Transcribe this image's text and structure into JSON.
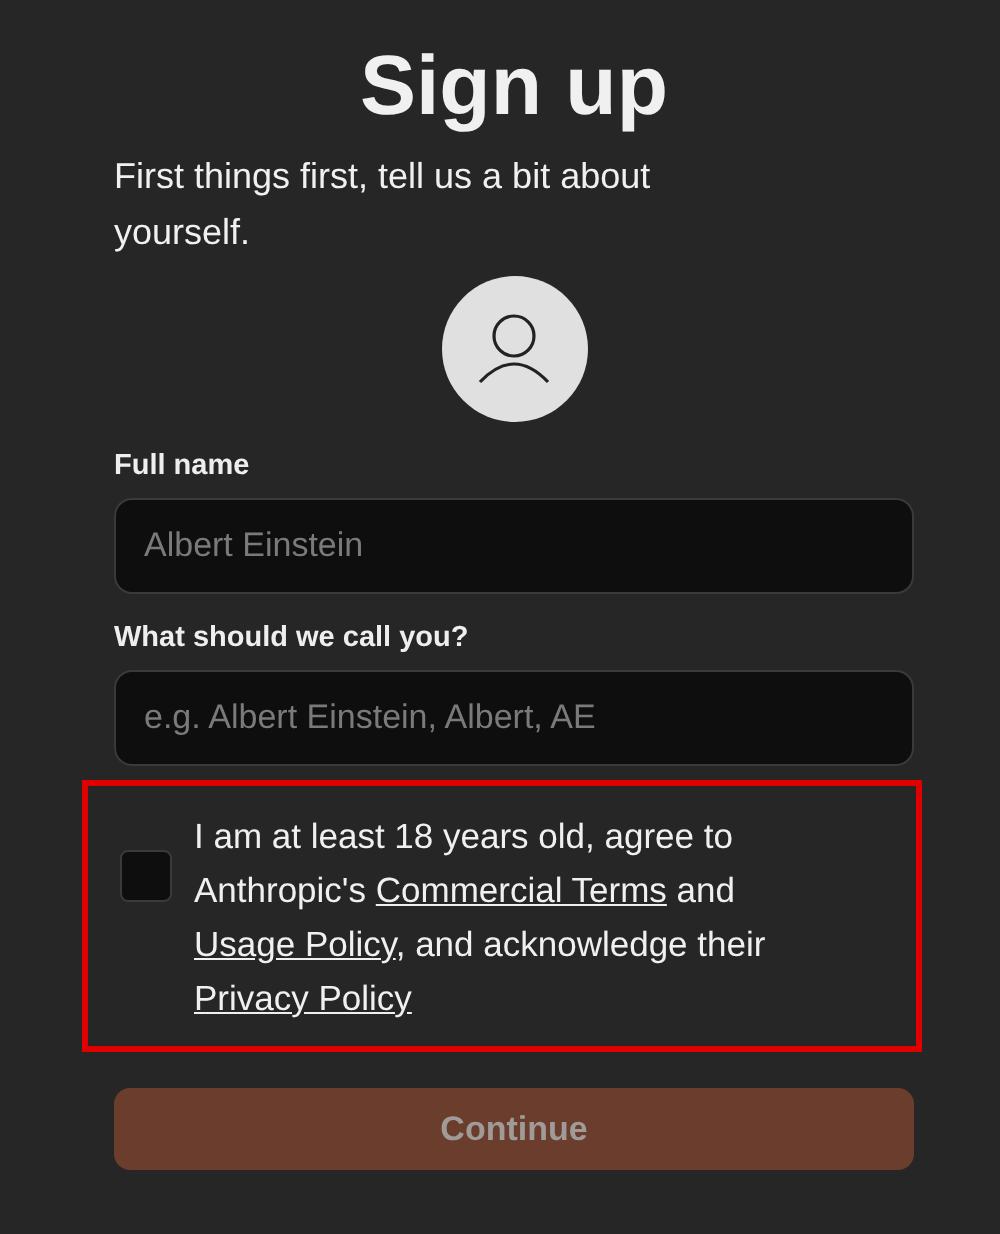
{
  "title": "Sign up",
  "subtitle": "First things first, tell us a bit about yourself.",
  "fields": [
    {
      "label": "Full name",
      "placeholder": "Albert Einstein"
    },
    {
      "label": "What should we call you?",
      "placeholder": "e.g. Albert Einstein, Albert, AE"
    }
  ],
  "consent": {
    "checked": false,
    "highlighted": true,
    "segments": [
      {
        "kind": "text",
        "text": "I am at least 18 years old, agree to Anthropic's "
      },
      {
        "kind": "link",
        "text": "Commercial Terms"
      },
      {
        "kind": "text",
        "text": " and "
      },
      {
        "kind": "link",
        "text": "Usage Policy"
      },
      {
        "kind": "text",
        "text": ", and acknowledge their "
      },
      {
        "kind": "link",
        "text": "Privacy Policy"
      }
    ]
  },
  "button": {
    "label": "Continue",
    "disabled": true
  }
}
